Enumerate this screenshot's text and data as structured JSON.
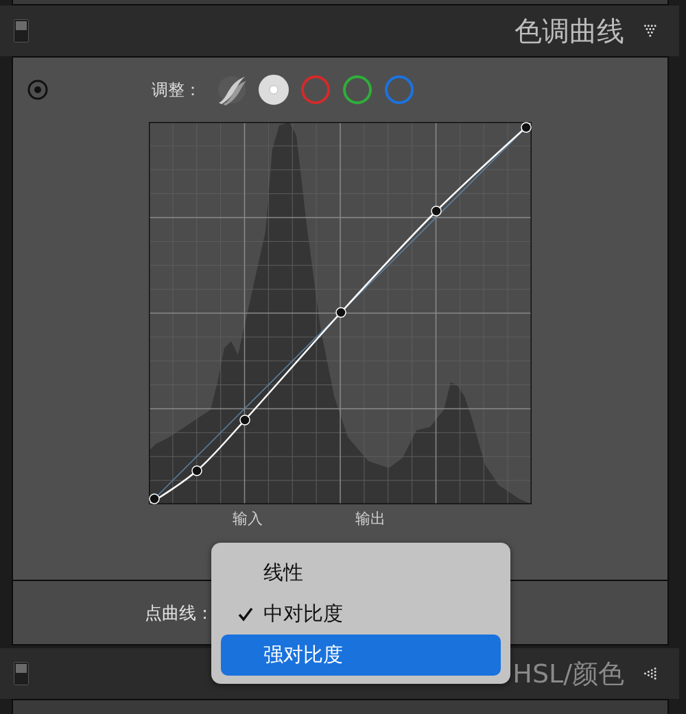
{
  "tone_curve_panel": {
    "title": "色调曲线",
    "expanded": true,
    "adjust": {
      "label": "调整：",
      "channels": [
        {
          "kind": "parametric",
          "selected": false
        },
        {
          "kind": "rgb",
          "selected": true
        },
        {
          "kind": "channel",
          "color": "#d42a2a",
          "selected": false
        },
        {
          "kind": "channel",
          "color": "#2fae3a",
          "selected": false
        },
        {
          "kind": "channel",
          "color": "#1b73e0",
          "selected": false
        }
      ]
    },
    "axis_labels": [
      "输入",
      "输出"
    ],
    "point_curve": {
      "label": "点曲线："
    },
    "menu": {
      "items": [
        {
          "label": "线性",
          "checked": false,
          "selected": false
        },
        {
          "label": "中对比度",
          "checked": true,
          "selected": false
        },
        {
          "label": "强对比度",
          "checked": false,
          "selected": true
        }
      ]
    }
  },
  "hsl_panel": {
    "title": "HSL/颜色",
    "expanded": false
  }
}
